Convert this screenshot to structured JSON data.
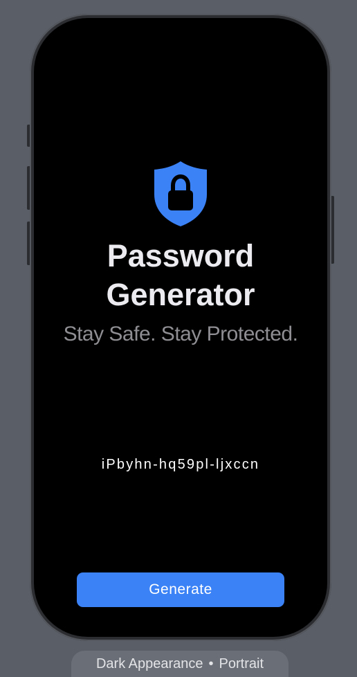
{
  "app": {
    "title_line1": "Password",
    "title_line2": "Generator",
    "tagline": "Stay Safe. Stay Protected.",
    "generated_password": "iPbyhn-hq59pl-ljxccn",
    "generate_label": "Generate"
  },
  "preview": {
    "appearance": "Dark Appearance",
    "separator": "•",
    "orientation": "Portrait"
  },
  "colors": {
    "accent": "#3b82f6",
    "screen_background": "#000000",
    "canvas_background": "#5a5e66",
    "title_text": "#ebebf0",
    "subtitle_text": "#8e8e93"
  },
  "icons": {
    "hero": "lock-shield-icon"
  }
}
